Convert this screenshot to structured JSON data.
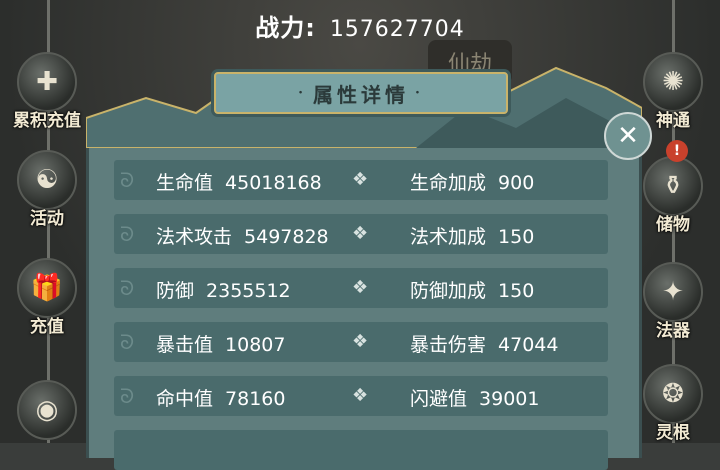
{
  "header": {
    "power_label": "战力:",
    "power_value": "157627704",
    "badge_text": "仙劫"
  },
  "panel": {
    "title": "属性详情",
    "title_dot_left": "·",
    "title_dot_right": "·",
    "rows": [
      {
        "left_name": "生命值",
        "left_value": "45018168",
        "right_name": "生命加成",
        "right_value": "900"
      },
      {
        "left_name": "法术攻击",
        "left_value": "5497828",
        "right_name": "法术加成",
        "right_value": "150"
      },
      {
        "left_name": "防御",
        "left_value": "2355512",
        "right_name": "防御加成",
        "right_value": "150"
      },
      {
        "left_name": "暴击值",
        "left_value": "10807",
        "right_name": "暴击伤害",
        "right_value": "47044"
      },
      {
        "left_name": "命中值",
        "left_value": "78160",
        "right_name": "闪避值",
        "right_value": "39001"
      }
    ]
  },
  "left_menu": [
    {
      "label": "累积充值",
      "icon": "cumulative-recharge-icon"
    },
    {
      "label": "活动",
      "icon": "taiji-icon"
    },
    {
      "label": "充值",
      "icon": "gift-icon"
    }
  ],
  "right_menu": [
    {
      "label": "神通",
      "icon": "divine-power-icon"
    },
    {
      "label": "储物",
      "icon": "storage-icon"
    },
    {
      "label": "法器",
      "icon": "artifact-icon"
    },
    {
      "label": "灵根",
      "icon": "spirit-root-icon"
    }
  ],
  "colors": {
    "panel": "#5f7d7d",
    "row": "#4a6b6c",
    "gold": "#c9b36a"
  }
}
